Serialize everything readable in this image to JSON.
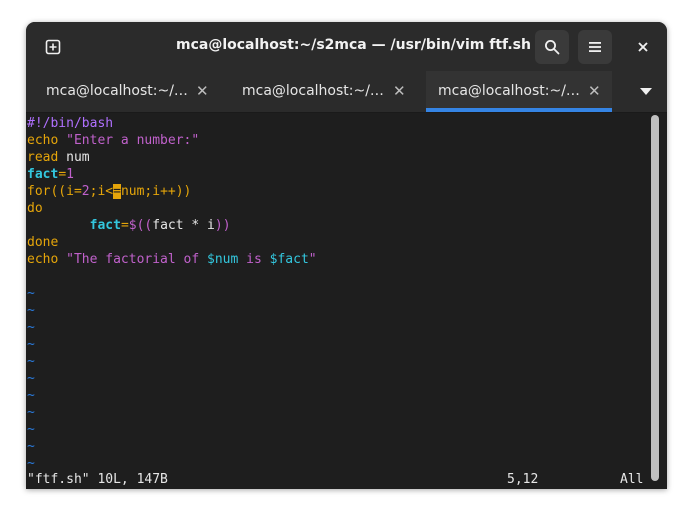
{
  "window": {
    "title": "mca@localhost:~/s2mca — /usr/bin/vim ftf.sh"
  },
  "tabs": [
    {
      "label": "mca@localhost:~/…",
      "close": "✕"
    },
    {
      "label": "mca@localhost:~/…",
      "close": "✕"
    },
    {
      "label": "mca@localhost:~/…",
      "close": "✕",
      "active": true
    }
  ],
  "editor": {
    "line1": "#!/bin/bash",
    "line2_cmd": "echo",
    "line2_str": "\"Enter a number:\"",
    "line3_cmd": "read",
    "line3_arg": " num",
    "line4_var": "fact",
    "line4_eq": "=",
    "line4_val": "1",
    "line5_pre": "for((i=",
    "line5_num": "2",
    "line5_mid": ";i<",
    "line5_cursor": "=",
    "line5_post": "num;i++))",
    "line6": "do",
    "line7_indent": "        ",
    "line7_var": "fact",
    "line7_eq": "=",
    "line7_open": "$((",
    "line7_expr": "fact * i",
    "line7_close": "))",
    "line8": "done",
    "line9_cmd": "echo",
    "line9_q1": "\"The factorial of ",
    "line9_v1": "$num",
    "line9_mid": " is ",
    "line9_v2": "$fact",
    "line9_q2": "\"",
    "tilde": "~",
    "status_file": "\"ftf.sh\" 10L, 147B",
    "status_pos": "5,12",
    "status_scroll": "All"
  },
  "colors": {
    "accent": "#3584e4",
    "keyword": "#e5a50a",
    "string": "#c061cb",
    "variable": "#33c7de",
    "tilde": "#2a7bde"
  },
  "icons": [
    "new-tab-icon",
    "search-icon",
    "hamburger-menu-icon",
    "close-icon",
    "tab-close-icon",
    "tab-list-dropdown-icon"
  ]
}
